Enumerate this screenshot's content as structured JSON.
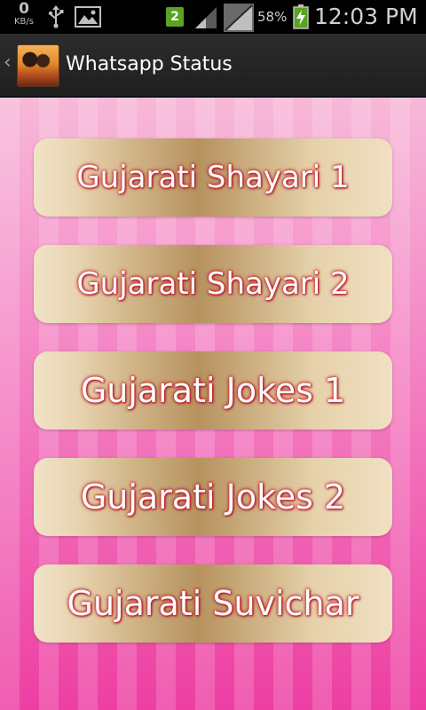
{
  "status_bar": {
    "net_speed": "0",
    "net_speed_unit": "KB/s",
    "notification_count": "2",
    "battery_percent": "58%",
    "time": "12:03 PM",
    "icons": [
      "usb-icon",
      "gallery-icon",
      "signal-icon",
      "battery-charging-icon"
    ],
    "notification_color": "#5aa321"
  },
  "action_bar": {
    "back_glyph": "‹",
    "title": "Whatsapp Status"
  },
  "menu": {
    "items": [
      {
        "label": "Gujarati Shayari 1"
      },
      {
        "label": "Gujarati Shayari 2"
      },
      {
        "label": "Gujarati Jokes 1"
      },
      {
        "label": "Gujarati Jokes 2"
      },
      {
        "label": "Gujarati Suvichar"
      }
    ]
  },
  "colors": {
    "background_top": "#f7b9d9",
    "background_bottom": "#ed3fa2",
    "button_gold": "#b6925f",
    "label_glow": "#c21d2a"
  }
}
